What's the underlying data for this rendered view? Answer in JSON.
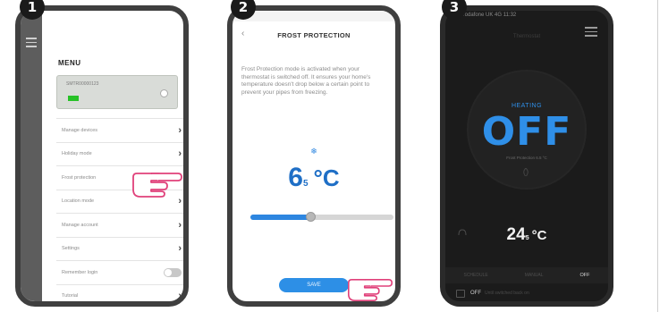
{
  "steps": [
    "1",
    "2",
    "3"
  ],
  "phone1": {
    "menu_title": "MENU",
    "device_name": "SMTR00000123",
    "items": [
      {
        "label": "Manage devices",
        "control": "chevron"
      },
      {
        "label": "Holiday mode",
        "control": "chevron"
      },
      {
        "label": "Frost protection",
        "control": "chevron"
      },
      {
        "label": "Location mode",
        "control": "chevron"
      },
      {
        "label": "Manage account",
        "control": "chevron"
      },
      {
        "label": "Settings",
        "control": "chevron"
      },
      {
        "label": "Remember login",
        "control": "toggle"
      },
      {
        "label": "Tutorial",
        "control": "chevron"
      }
    ],
    "chevron": "›"
  },
  "phone2": {
    "title": "FROST PROTECTION",
    "back": "‹",
    "description": "Frost Protection mode is activated when your thermostat is switched off. It ensures your home's temperature doesn't drop below a certain point to prevent your pipes from freezing.",
    "snow_icon": "❄",
    "temp_whole": "6",
    "temp_decimal": "5",
    "temp_unit": "°C",
    "slider_level": 0.42,
    "save_label": "SAVE"
  },
  "phone3": {
    "carrier": "Vodafone UK 4G 11:32",
    "thermostat_name": "Thermostat",
    "heating_label": "HEATING",
    "state": "OFF",
    "sub_label": "Frost Protection 6.5 °C",
    "room_whole": "24",
    "room_decimal": "5",
    "room_unit": "°C",
    "modes": [
      {
        "label": "SCHEDULE",
        "active": false
      },
      {
        "label": "MANUAL",
        "active": false
      },
      {
        "label": "OFF",
        "active": true
      }
    ],
    "bottom_state": "OFF",
    "bottom_note": "Until switched back on"
  },
  "colors": {
    "accent_blue": "#2d86e0",
    "frame": "#3f3f3f",
    "led_green": "#27c227"
  }
}
